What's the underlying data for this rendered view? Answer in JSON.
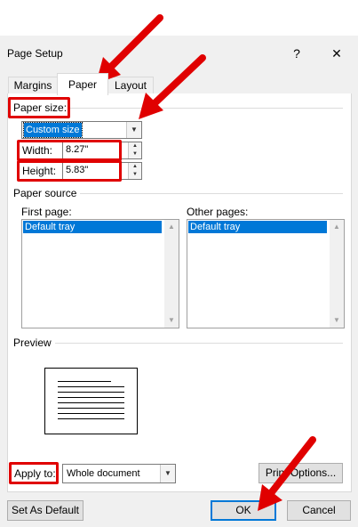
{
  "dialog": {
    "title": "Page Setup",
    "help": "?",
    "close": "✕"
  },
  "tabs": [
    {
      "label": "Margins"
    },
    {
      "label": "Paper"
    },
    {
      "label": "Layout"
    }
  ],
  "paper_size": {
    "label": "Paper size:",
    "value": "Custom size",
    "width_label": "Width:",
    "width_value": "8.27\"",
    "height_label": "Height:",
    "height_value": "5.83\""
  },
  "paper_source": {
    "label": "Paper source",
    "first_page_label": "First page:",
    "first_page_selected": "Default tray",
    "other_pages_label": "Other pages:",
    "other_pages_selected": "Default tray"
  },
  "preview": {
    "label": "Preview"
  },
  "apply_to": {
    "label": "Apply to:",
    "value": "Whole document"
  },
  "buttons": {
    "print_options": "Print Options...",
    "set_default": "Set As Default",
    "ok": "OK",
    "cancel": "Cancel"
  },
  "colors": {
    "highlight": "#0078d7",
    "annotation_red": "#e00000"
  }
}
